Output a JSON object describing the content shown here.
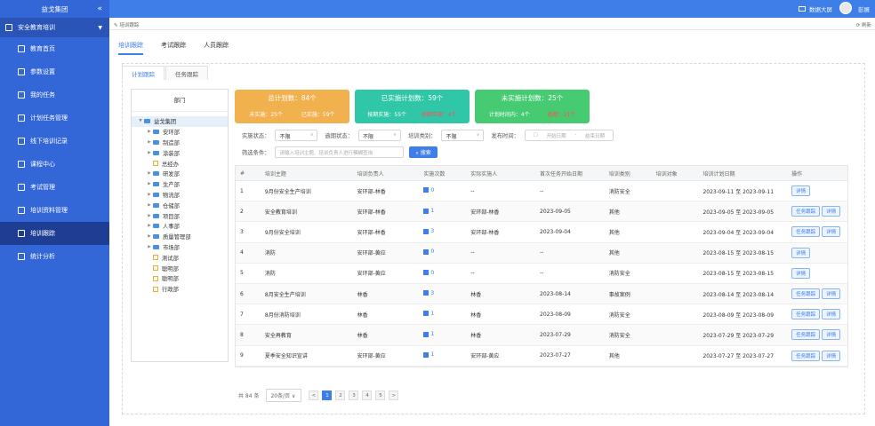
{
  "sidebar": {
    "brand": "益戈集团",
    "system": "安全教育培训",
    "items": [
      {
        "label": "教育首页",
        "active": false
      },
      {
        "label": "参数设置",
        "active": false
      },
      {
        "label": "我的任务",
        "active": false
      },
      {
        "label": "计划任务管理",
        "active": false
      },
      {
        "label": "线下培训记录",
        "active": false
      },
      {
        "label": "课程中心",
        "active": false
      },
      {
        "label": "考试管理",
        "active": false
      },
      {
        "label": "培训资料管理",
        "active": false
      },
      {
        "label": "培训跟踪",
        "active": true
      },
      {
        "label": "统计分析",
        "active": false
      }
    ]
  },
  "topbar": {
    "big_screen": "数据大屏",
    "user": "彭展"
  },
  "tagsbar": {
    "breadcrumb": "培训跟踪",
    "refresh": "刷新"
  },
  "tabs": [
    "培训跟踪",
    "考试跟踪",
    "人员跟踪"
  ],
  "subtabs": [
    "计划跟踪",
    "任务跟踪"
  ],
  "tree": {
    "title": "部门",
    "nodes": [
      {
        "label": "益戈集团",
        "root": true,
        "type": "folder",
        "arrow": "▼"
      },
      {
        "label": "安环部",
        "type": "folder",
        "arrow": "▶"
      },
      {
        "label": "制造部",
        "type": "folder",
        "arrow": "▶"
      },
      {
        "label": "涂装部",
        "type": "folder",
        "arrow": "▶"
      },
      {
        "label": "总经办",
        "type": "file",
        "arrow": ""
      },
      {
        "label": "研发部",
        "type": "folder",
        "arrow": "▶"
      },
      {
        "label": "生产部",
        "type": "folder",
        "arrow": "▶"
      },
      {
        "label": "物流部",
        "type": "folder",
        "arrow": "▶"
      },
      {
        "label": "仓储部",
        "type": "folder",
        "arrow": "▶"
      },
      {
        "label": "项目部",
        "type": "folder",
        "arrow": "▶"
      },
      {
        "label": "人事部",
        "type": "folder",
        "arrow": "▶"
      },
      {
        "label": "质量管理部",
        "type": "folder",
        "arrow": "▶"
      },
      {
        "label": "市场部",
        "type": "folder",
        "arrow": "▶"
      },
      {
        "label": "测试部",
        "type": "file",
        "arrow": ""
      },
      {
        "label": "聪明部",
        "type": "file",
        "arrow": ""
      },
      {
        "label": "聪明部",
        "type": "file",
        "arrow": ""
      },
      {
        "label": "行政部",
        "type": "file",
        "arrow": ""
      }
    ]
  },
  "cards": [
    {
      "title": "总计划数：84个",
      "a": "未实施：25个",
      "b": "已实施：59个",
      "b_red": false
    },
    {
      "title": "已实施计划数：59个",
      "a": "按期实施：55个",
      "b": "逾期实施：4个",
      "b_red": true
    },
    {
      "title": "未实施计划数：25个",
      "a": "计划时间内：4个",
      "b": "逾期：21个",
      "b_red": true
    }
  ],
  "filters": {
    "status_label": "实施状态：",
    "status_value": "不限",
    "overdue_label": "逾期状态：",
    "overdue_value": "不限",
    "category_label": "培训类别：",
    "category_value": "不限",
    "date_label": "发布时间：",
    "date_start": "开始日期",
    "date_sep": "-",
    "date_end": "结束日期",
    "cond_label": "筛选条件：",
    "keyword_placeholder": "请输入培训主题、培训负责人进行模糊查询",
    "search": "搜索"
  },
  "table": {
    "headers": [
      "#",
      "培训主题",
      "培训负责人",
      "实施次数",
      "实际实施人",
      "首次任务开始日期",
      "培训类别",
      "培训对象",
      "培训计划日期",
      "操作"
    ],
    "rows": [
      {
        "no": "1",
        "topic": "9月份安全生产培训",
        "owner": "安环部-林香",
        "count": "0",
        "actual": "--",
        "first": "--",
        "category": "消防安全",
        "target": "",
        "plan": "2023-09-11 至 2023-09-11",
        "ops": [
          "详情"
        ]
      },
      {
        "no": "2",
        "topic": "安全教育培训",
        "owner": "安环部-林香",
        "count": "1",
        "actual": "安环部-林香",
        "first": "2023-09-05",
        "category": "其他",
        "target": "",
        "plan": "2023-09-05 至 2023-09-05",
        "ops": [
          "任务跟踪",
          "详情"
        ]
      },
      {
        "no": "3",
        "topic": "9月份安全培训",
        "owner": "安环部-林香",
        "count": "3",
        "actual": "安环部-林香",
        "first": "2023-09-04",
        "category": "其他",
        "target": "",
        "plan": "2023-09-04 至 2023-09-04",
        "ops": [
          "任务跟踪",
          "详情"
        ]
      },
      {
        "no": "4",
        "topic": "消防",
        "owner": "安环部-黄应",
        "count": "0",
        "actual": "--",
        "first": "--",
        "category": "其他",
        "target": "",
        "plan": "2023-08-15 至 2023-08-15",
        "ops": [
          "详情"
        ]
      },
      {
        "no": "5",
        "topic": "消防",
        "owner": "安环部-黄应",
        "count": "0",
        "actual": "--",
        "first": "--",
        "category": "消防安全",
        "target": "",
        "plan": "2023-08-15 至 2023-08-15",
        "ops": [
          "详情"
        ]
      },
      {
        "no": "6",
        "topic": "8月安全生产培训",
        "owner": "林香",
        "count": "3",
        "actual": "林香",
        "first": "2023-08-14",
        "category": "事故案例",
        "target": "",
        "plan": "2023-08-14 至 2023-08-14",
        "ops": [
          "任务跟踪",
          "详情"
        ]
      },
      {
        "no": "7",
        "topic": "8月份消防培训",
        "owner": "林香",
        "count": "1",
        "actual": "林香",
        "first": "2023-08-09",
        "category": "消防安全",
        "target": "",
        "plan": "2023-08-09 至 2023-08-09",
        "ops": [
          "任务跟踪",
          "详情"
        ]
      },
      {
        "no": "8",
        "topic": "安全再教育",
        "owner": "林香",
        "count": "1",
        "actual": "林香",
        "first": "2023-07-29",
        "category": "消防安全",
        "target": "",
        "plan": "2023-07-29 至 2023-07-29",
        "ops": [
          "任务跟踪",
          "详情"
        ]
      },
      {
        "no": "9",
        "topic": "夏季安全知识宣讲",
        "owner": "安环部-黄应",
        "count": "1",
        "actual": "安环部-黄应",
        "first": "2023-07-27",
        "category": "其他",
        "target": "",
        "plan": "2023-07-27 至 2023-07-27",
        "ops": [
          "任务跟踪",
          "详情"
        ]
      }
    ]
  },
  "pager": {
    "total": "共 84 条",
    "size": "20条/页",
    "pages": [
      "1",
      "2",
      "3",
      "4",
      "5"
    ],
    "current": "1",
    "prev": "<",
    "next": ">"
  },
  "colors": {
    "sidebar": "#3366d6",
    "topbar": "#3d7ee8",
    "card1": "#f2b14f",
    "card2": "#30c7a8",
    "card3": "#46cb73"
  }
}
